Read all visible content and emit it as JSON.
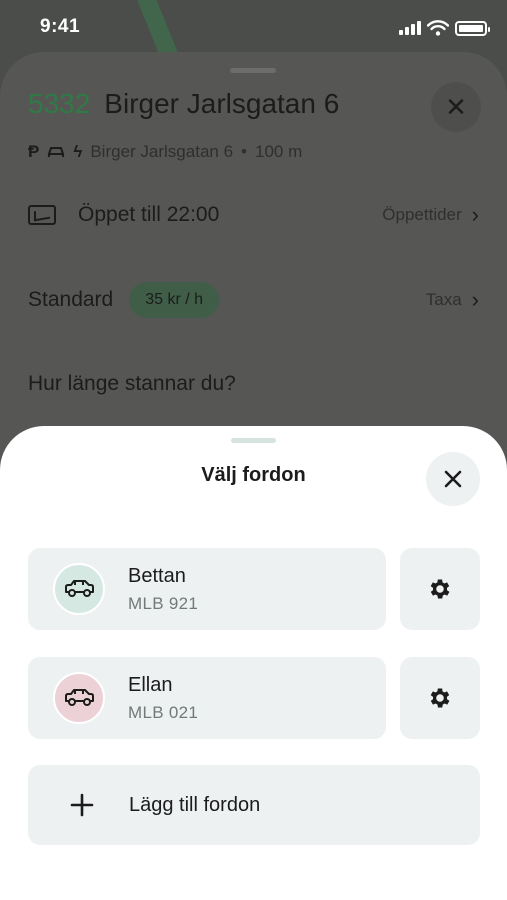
{
  "status_bar": {
    "time": "9:41"
  },
  "background": {
    "stop_code": "5332",
    "stop_name": "Birger Jarlsgatan 6",
    "subtitle_address": "Birger Jarlsgatan 6",
    "subtitle_distance": "100 m",
    "subtitle_icons": [
      "parking-icon",
      "car-icon",
      "lightning-icon"
    ],
    "opening_label": "Öppet till 22:00",
    "opening_link": "Öppettider",
    "rate_label": "Standard",
    "rate_price": "35 kr / h",
    "rate_link": "Taxa",
    "duration_question": "Hur länge stannar du?"
  },
  "sheet": {
    "title": "Välj fordon",
    "vehicles": [
      {
        "name": "Bettan",
        "plate": "MLB 921",
        "avatar_color": "#d5e9e2"
      },
      {
        "name": "Ellan",
        "plate": "MLB 021",
        "avatar_color": "#ecd2d6"
      }
    ],
    "add_label": "Lägg till fordon"
  },
  "colors": {
    "accent_green": "#2f7a45",
    "card_bg": "#eef1f2",
    "plate_gray": "#6f7a79"
  }
}
